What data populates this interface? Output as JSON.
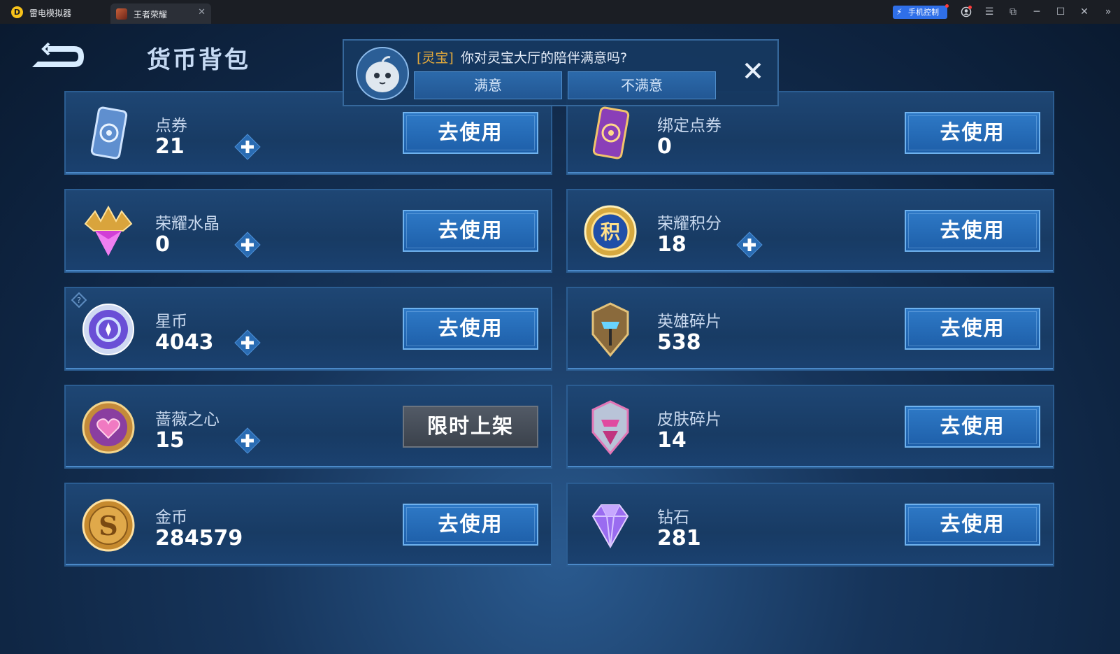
{
  "emulator": {
    "app_name": "雷电模拟器",
    "tab_label": "王者荣耀",
    "tab_close": "✕",
    "phone_control": "手机控制",
    "controls": {
      "menu": "☰",
      "screenshot": "⧉",
      "minimize": "─",
      "maximize": "☐",
      "close": "✕",
      "expand": "»"
    }
  },
  "page": {
    "title": "货币背包"
  },
  "popup": {
    "tag": "[灵宝]",
    "question": "你对灵宝大厅的陪伴满意吗?",
    "satisfied": "满意",
    "unsatisfied": "不满意"
  },
  "currencies": [
    {
      "name": "点券",
      "value": "21",
      "button": "去使用",
      "icon": "coupon-icon"
    },
    {
      "name": "绑定点券",
      "value": "0",
      "button": "去使用",
      "icon": "bound-coupon-icon"
    },
    {
      "name": "荣耀水晶",
      "value": "0",
      "button": "去使用",
      "icon": "glory-crystal-icon"
    },
    {
      "name": "荣耀积分",
      "value": "18",
      "button": "去使用",
      "icon": "glory-points-icon",
      "icon_glyph": "积"
    },
    {
      "name": "星币",
      "value": "4043",
      "button": "去使用",
      "icon": "star-coin-icon"
    },
    {
      "name": "英雄碎片",
      "value": "538",
      "button": "去使用",
      "icon": "hero-fragment-icon"
    },
    {
      "name": "蔷薇之心",
      "value": "15",
      "button": "限时上架",
      "icon": "rose-heart-icon"
    },
    {
      "name": "皮肤碎片",
      "value": "14",
      "button": "去使用",
      "icon": "skin-fragment-icon"
    },
    {
      "name": "金币",
      "value": "284579",
      "button": "去使用",
      "icon": "gold-coin-icon",
      "icon_glyph": "S"
    },
    {
      "name": "钻石",
      "value": "281",
      "button": "去使用",
      "icon": "diamond-icon"
    }
  ]
}
